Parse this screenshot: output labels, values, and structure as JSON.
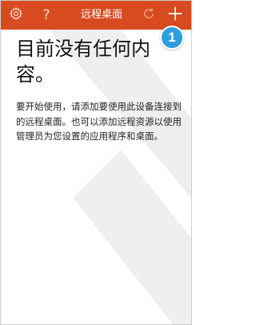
{
  "header": {
    "title": "远程桌面",
    "settings_icon": "gear-icon",
    "help_icon": "question-mark-icon",
    "help_glyph": "?",
    "refresh_icon": "refresh-icon",
    "add_icon": "plus-icon",
    "color": "#d84a20"
  },
  "step_badge": {
    "number": "1",
    "color": "#2e9fdd"
  },
  "empty_state": {
    "title": "目前没有任何内容。",
    "description": "要开始使用，请添加要使用此设备连接到的远程桌面。也可以添加远程资源以使用管理员为您设置的应用程序和桌面。"
  },
  "watermark": {
    "icon": "remote-desktop-logo-icon",
    "color": "#efefef"
  }
}
